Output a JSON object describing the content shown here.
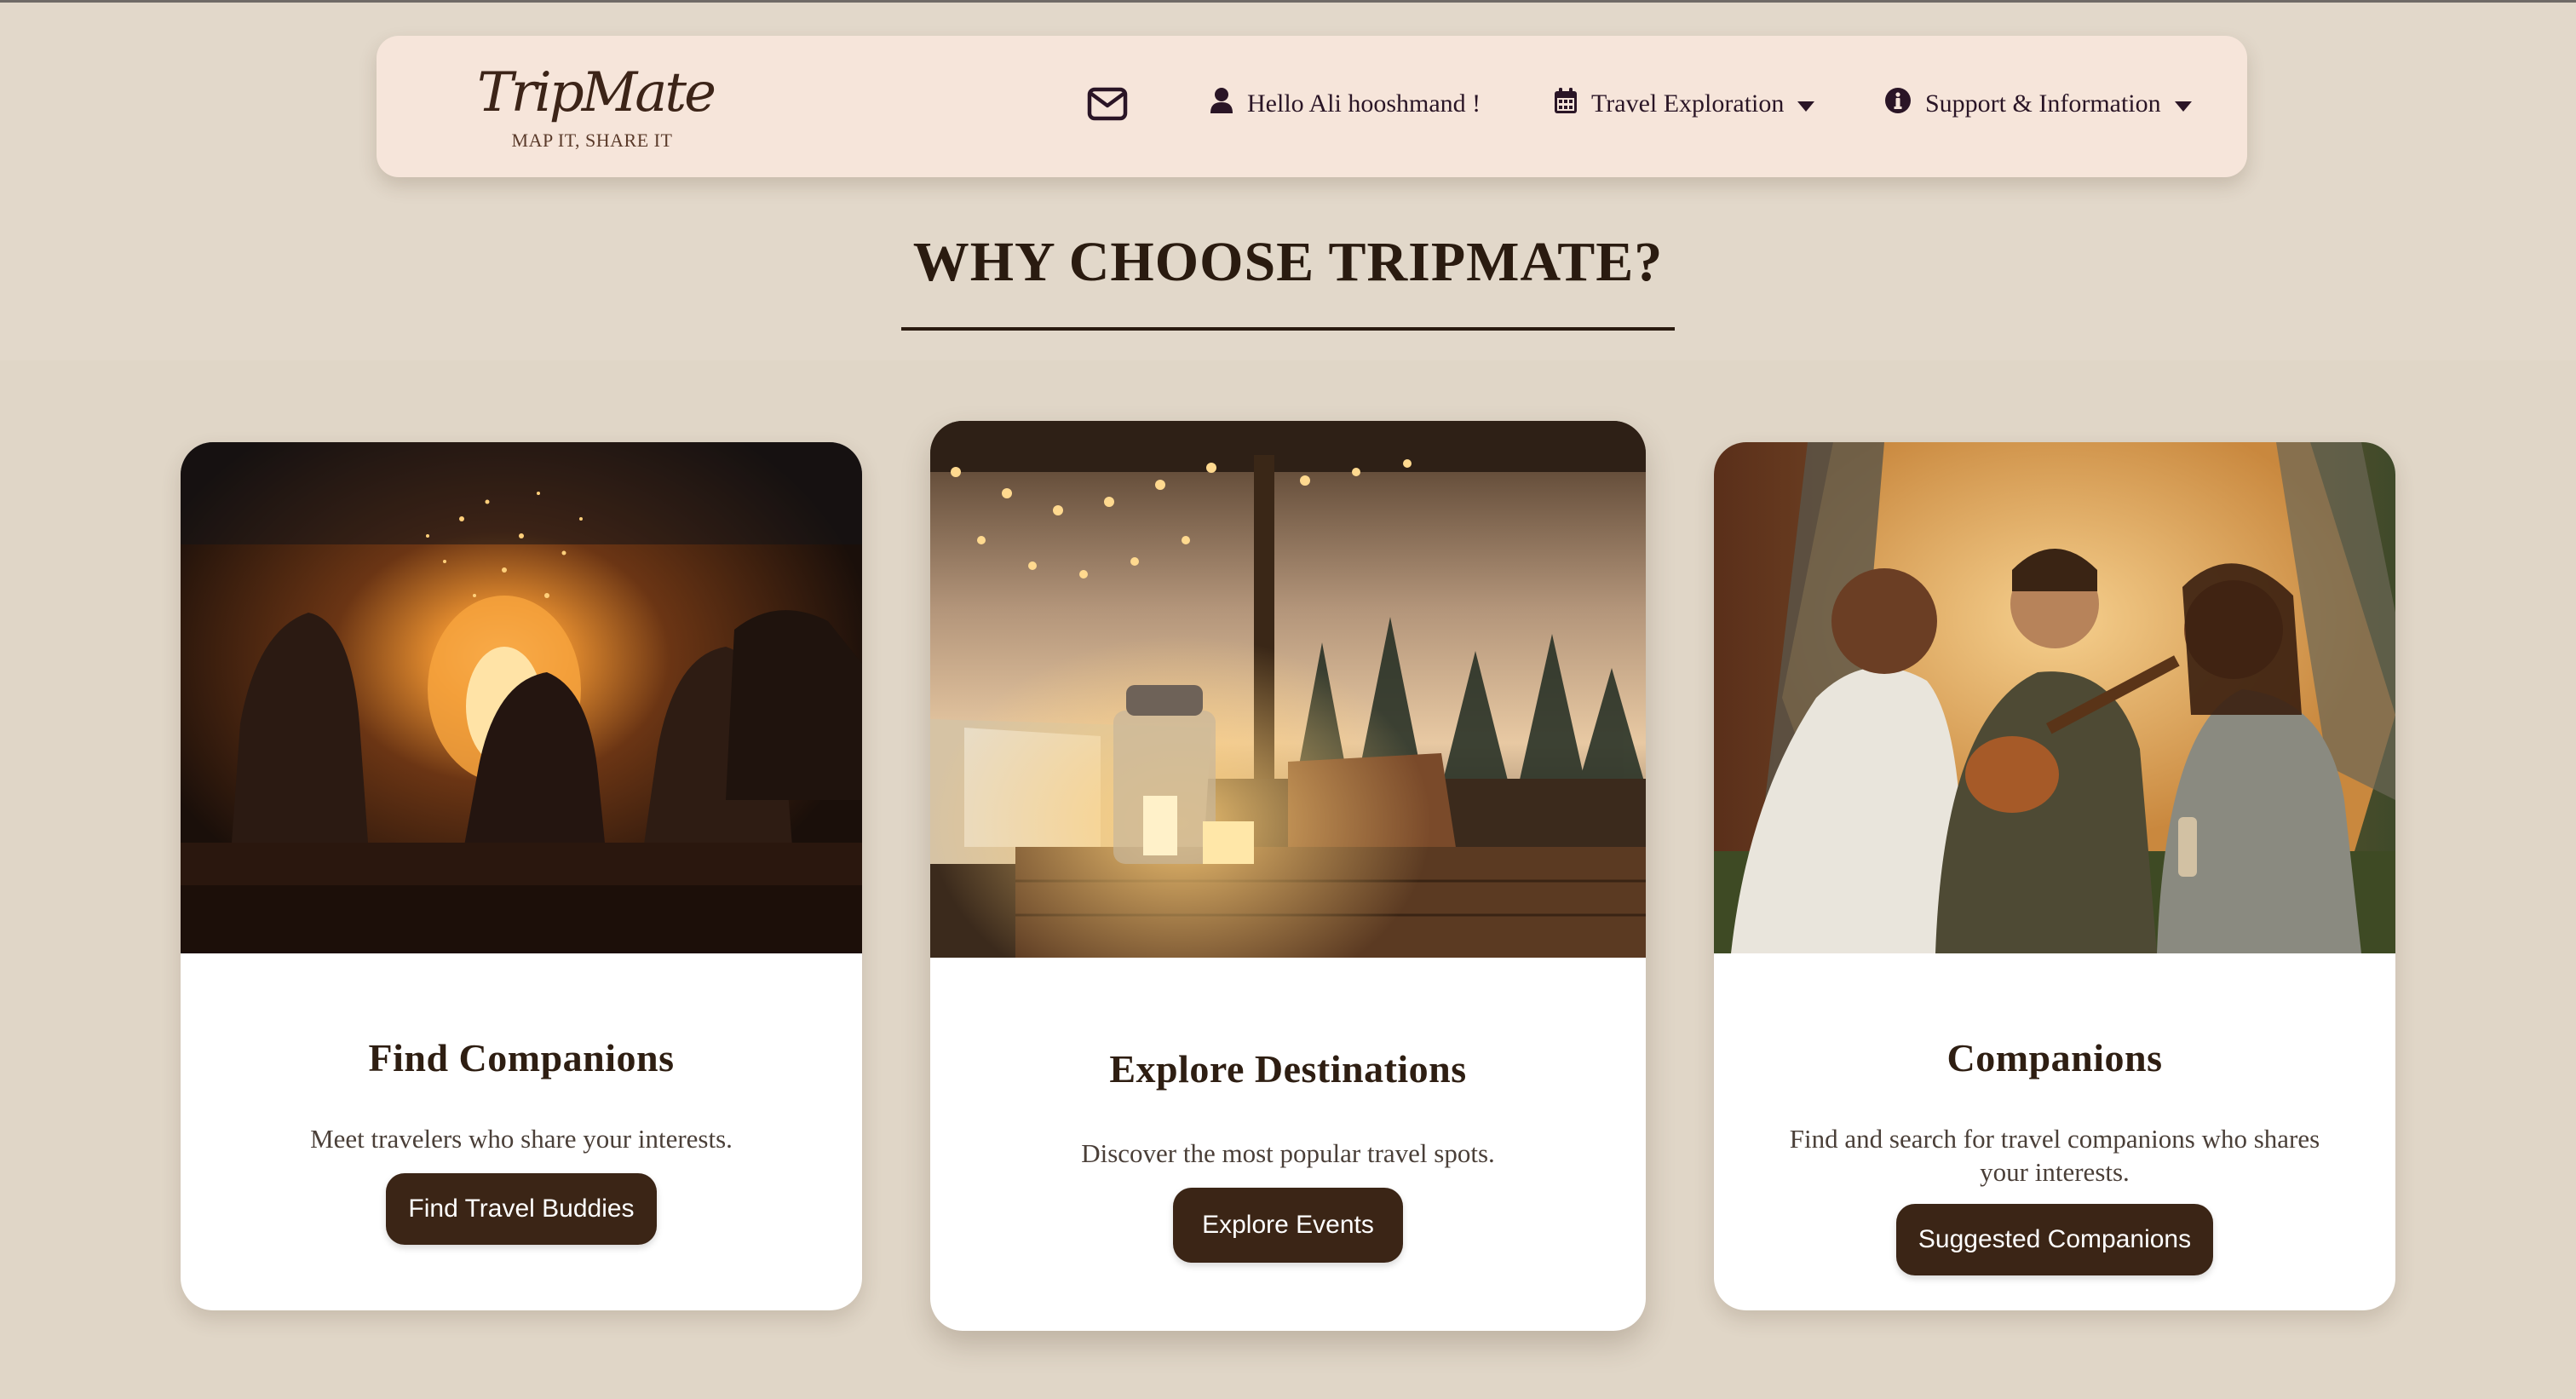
{
  "brand": {
    "name": "TripMate",
    "tagline": "MAP IT, SHARE IT"
  },
  "nav": {
    "mail_icon": "envelope-icon",
    "user_label": "Hello Ali hooshmand !",
    "travel_label": "Travel Exploration",
    "support_label": "Support & Information"
  },
  "section": {
    "title": "WHY CHOOSE TRIPMATE?"
  },
  "cards": [
    {
      "image_icon": "campfire-photo",
      "title": "Find Companions",
      "description": "Meet travelers who share your interests.",
      "button": "Find Travel Buddies"
    },
    {
      "image_icon": "patio-lantern-photo",
      "title": "Explore Destinations",
      "description": "Discover the most popular travel spots.",
      "button": "Explore Events"
    },
    {
      "image_icon": "tent-guitar-photo",
      "title": "Companions",
      "description": "Find and search for travel companions who shares your interests.",
      "button": "Suggested Companions"
    }
  ],
  "colors": {
    "page_bg": "#e0d6c7",
    "navbar_bg": "#f6e5da",
    "button_bg": "#3b2516",
    "heading": "#2a1b10"
  }
}
